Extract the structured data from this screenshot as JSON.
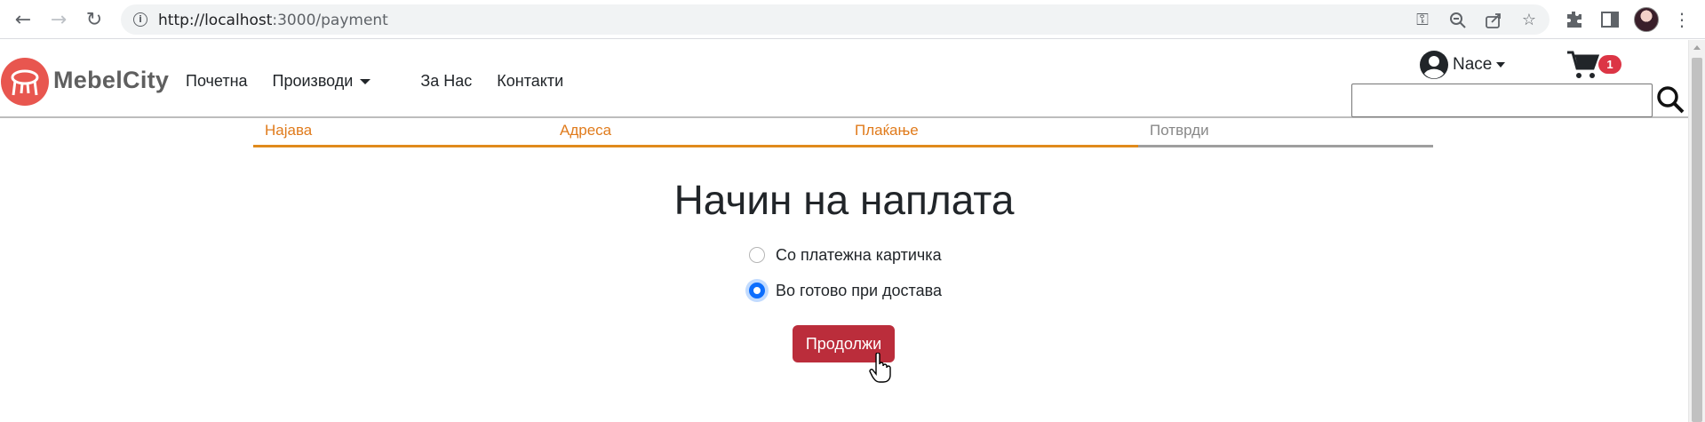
{
  "browser": {
    "url_host": "http://localhost",
    "url_path": ":3000/payment",
    "icons": [
      "back-icon",
      "forward-icon",
      "reload-icon",
      "info-icon",
      "key-icon",
      "zoom-out-icon",
      "share-icon",
      "bookmark-star-icon",
      "extensions-icon",
      "sidebar-icon",
      "profile-avatar",
      "menu-dots-icon"
    ]
  },
  "site": {
    "logo_text": "MebelCity",
    "nav": {
      "home": "Почетна",
      "products": "Производи",
      "about": "За Нас",
      "contacts": "Контакти"
    },
    "user_name": "Nace",
    "cart_count": "1",
    "search_value": "",
    "colors": {
      "logo": "#e8564f",
      "step_active": "#e07b1c",
      "button": "#bb2d3b",
      "badge": "#dc3545",
      "radio": "#0d6efd"
    }
  },
  "steps": [
    {
      "label": "Најава",
      "active": true
    },
    {
      "label": "Адреса",
      "active": true
    },
    {
      "label": "Плаќање",
      "active": true
    },
    {
      "label": "Потврди",
      "active": false
    }
  ],
  "payment": {
    "title": "Начин на наплата",
    "options": [
      {
        "label": "Со платежна картичка",
        "checked": false
      },
      {
        "label": "Во готово при достава",
        "checked": true
      }
    ],
    "continue_label": "Продолжи"
  }
}
